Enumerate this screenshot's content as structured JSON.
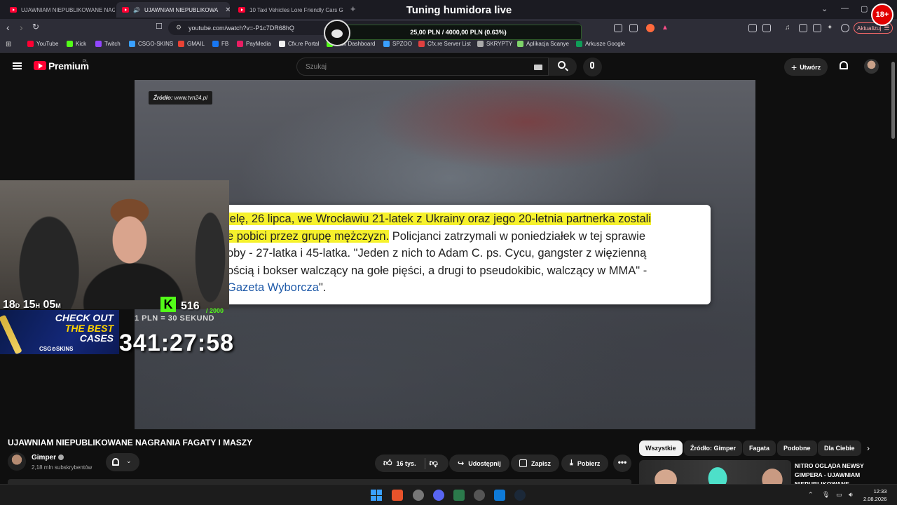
{
  "stream": {
    "title": "Tuning humidora live",
    "goal_text": "25,00 PLN / 4000,00 PLN  (0.63%)",
    "goal_progress_percent": 0.63,
    "age_badge": "18+",
    "countdown_days": "18",
    "countdown_hours": "15",
    "countdown_minutes": "05",
    "countdown_unit_d": "D",
    "countdown_unit_h": "H",
    "countdown_unit_m": "M",
    "kick_letter": "K",
    "sub_count": "516",
    "sub_goal": "/ 2000",
    "rate": "1 PLN = 30 SEKUND",
    "big_timer": "341:27:58",
    "ad_line1": "CHECK OUT",
    "ad_line2": "THE BEST",
    "ad_line3": "CASES",
    "ad_brand": "CSG⊙SKINS"
  },
  "browser": {
    "tabs": [
      {
        "label": "UJAWNIAM NIEPUBLIKOWANE NAGR"
      },
      {
        "label": "UJAWNIAM NIEPUBLIKOWA"
      },
      {
        "label": "10 Taxi Vehicles Lore Friendly Cars GT"
      }
    ],
    "new_tab": "+",
    "url": "youtube.com/watch?v=-P1c7DR68hQ",
    "update_label": "Aktualizuj",
    "bookmarks": [
      {
        "label": "YouTube",
        "color": "#ff0033"
      },
      {
        "label": "Kick",
        "color": "#53fc18"
      },
      {
        "label": "Twitch",
        "color": "#9146ff"
      },
      {
        "label": "CSGO-SKINS",
        "color": "#3aa0ff"
      },
      {
        "label": "GMAIL",
        "color": "#ea4335"
      },
      {
        "label": "FB",
        "color": "#1877f2"
      },
      {
        "label": "PayMedia",
        "color": "#e91e63"
      },
      {
        "label": "Cfx.re Portal",
        "color": "#f0f0f0"
      },
      {
        "label": "Kick Dashboard",
        "color": "#53fc18"
      },
      {
        "label": "SPZOO",
        "color": "#3aa0ff"
      },
      {
        "label": "Cfx.re Server List",
        "color": "#e04040"
      },
      {
        "label": "SKRYPTY",
        "color": "#aaaaaa"
      },
      {
        "label": "Aplikacja Scanye",
        "color": "#7fd46a"
      },
      {
        "label": "Arkusze Google",
        "color": "#0f9d58"
      }
    ]
  },
  "youtube": {
    "brand": "Premium",
    "region": "PL",
    "search_placeholder": "Szukaj",
    "create_label": "Utwórz"
  },
  "video": {
    "source_label": "Źródło:",
    "source_value": "www.tvn24.pl",
    "quote": {
      "line1_hl": "ielę, 26 lipca, we Wrocławiu 21-latek z Ukrainy oraz jego 20-letnia partnerka zostali",
      "line2_hl": "e pobici przez grupę mężczyzn.",
      "line2_rest": " Policjanci zatrzymali w poniedziałek w tej sprawie",
      "line3": "oby - 27-latka i 45-latka. \"Jeden z nich to Adam C. ps. Cycu, gangster z więzienną",
      "line4": "ością i bokser walczący na gołe pięści, a drugi to pseudokibic, walczący w MMA\" -",
      "line5_link": "Gazeta Wyborcza",
      "line5_end": "\"."
    }
  },
  "info": {
    "title": "UJAWNIAM NIEPUBLIKOWANE NAGRANIA FAGATY I MASZY",
    "channel": "Gimper",
    "subscribers": "2,18 mln subskrybentów",
    "likes": "16 tys.",
    "share": "Udostępnij",
    "save": "Zapisz",
    "download": "Pobierz",
    "more": "•••"
  },
  "recommendations": {
    "chips": [
      "Wszystkie",
      "Źródło: Gimper",
      "Fagata",
      "Podobne",
      "Dla Ciebie"
    ],
    "first_title": "NITRO OGLĄDA NEWSY GIMPERA - UJAWNIAM NIEPUBLIKOWANE"
  },
  "taskbar": {
    "time": "12:33",
    "date": "2.08.2026"
  }
}
